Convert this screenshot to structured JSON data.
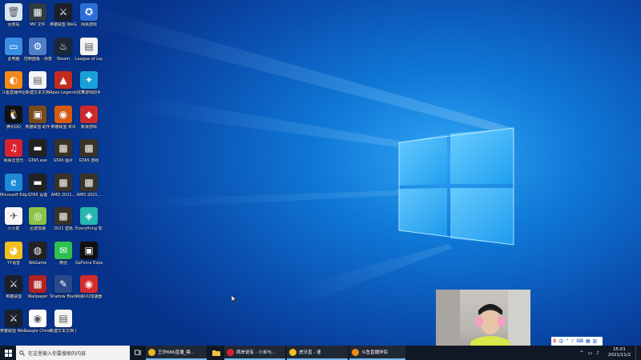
{
  "desktop_icons": [
    {
      "label": "回收站",
      "color": "#d8e4ef",
      "glyph": "🗑"
    },
    {
      "label": "MV 文件",
      "color": "#2f3a44",
      "glyph": "▦"
    },
    {
      "label": "英雄联盟 WeGame版",
      "color": "#1b1f2a",
      "glyph": "⚔"
    },
    {
      "label": "网易游戏",
      "color": "#2b6fd6",
      "glyph": "✪"
    },
    {
      "label": "此电脑",
      "color": "#3a8ee6",
      "glyph": "▭"
    },
    {
      "label": "控制面板 - 快捷方式",
      "color": "#4f7fc9",
      "glyph": "⚙"
    },
    {
      "label": "Steam",
      "color": "#1b2838",
      "glyph": "♨"
    },
    {
      "label": "League of Legends",
      "color": "#f4f4f4",
      "glyph": "▤"
    },
    {
      "label": "斗鱼直播伴侣",
      "color": "#f28a1a",
      "glyph": "◐"
    },
    {
      "label": "新建文本文档",
      "color": "#f4f4f4",
      "glyph": "▤"
    },
    {
      "label": "Apex Legends",
      "color": "#c42b1c",
      "glyph": "▲"
    },
    {
      "label": "炫舞游戏助手",
      "color": "#18a0d8",
      "glyph": "✦"
    },
    {
      "label": "腾讯QQ",
      "color": "#111111",
      "glyph": "🐧"
    },
    {
      "label": "英雄联盟 助手",
      "color": "#7a4a1a",
      "glyph": "▣"
    },
    {
      "label": "英雄联盟 资讯",
      "color": "#d45a12",
      "glyph": "◉"
    },
    {
      "label": "新浪游戏",
      "color": "#cc2b2b",
      "glyph": "◆"
    },
    {
      "label": "网易云音乐",
      "color": "#d8232f",
      "glyph": "♫"
    },
    {
      "label": "GTA5.exe",
      "color": "#222222",
      "glyph": "▬"
    },
    {
      "label": "GTA5 图片",
      "color": "#3a3228",
      "glyph": "▩"
    },
    {
      "label": "GTA5 游戏",
      "color": "#3a3228",
      "glyph": "▩"
    },
    {
      "label": "Microsoft Edge",
      "color": "#1e8ad6",
      "glyph": "e"
    },
    {
      "label": "GTA5 设置",
      "color": "#222222",
      "glyph": "▬"
    },
    {
      "label": "AMD 2021...",
      "color": "#3a3228",
      "glyph": "▩"
    },
    {
      "label": "AMD 2021...",
      "color": "#3a3228",
      "glyph": "▩"
    },
    {
      "label": "小火箭",
      "color": "#f6f6f6",
      "glyph": "✈"
    },
    {
      "label": "迅游加速",
      "color": "#8bc34a",
      "glyph": "◎"
    },
    {
      "label": "2021 壁纸",
      "color": "#3a3228",
      "glyph": "▩"
    },
    {
      "label": "Everything 软件",
      "color": "#25b7b0",
      "glyph": "◈"
    },
    {
      "label": "YY语音",
      "color": "#f0c020",
      "glyph": "◕"
    },
    {
      "label": "WeGame",
      "color": "#222222",
      "glyph": "◍"
    },
    {
      "label": "微信",
      "color": "#2ec04f",
      "glyph": "✉"
    },
    {
      "label": "GeForce Experience",
      "color": "#111111",
      "glyph": "▣"
    },
    {
      "label": "英雄联盟",
      "color": "#1b1f2a",
      "glyph": "⚔"
    },
    {
      "label": "Wallpaper",
      "color": "#b02323",
      "glyph": "▦"
    },
    {
      "label": "Shadow Blade",
      "color": "#2a4a8a",
      "glyph": "✎"
    },
    {
      "label": "网易UU加速器",
      "color": "#d42b2b",
      "glyph": "◉"
    },
    {
      "label": "英雄联盟 WeGame版",
      "color": "#1b1f2a",
      "glyph": "⚔"
    },
    {
      "label": "Google Chrome",
      "color": "#ffffff",
      "glyph": "◉"
    },
    {
      "label": "新建文本文档 (2)",
      "color": "#f4f4f4",
      "glyph": "▤"
    }
  ],
  "taskbar": {
    "search_placeholder": "在这里输入你要搜索的内容",
    "apps": [
      {
        "label": "王炸666直播_鼎...",
        "color": "#e8b923"
      },
      {
        "label": "两岸说有 - 小米与...",
        "color": "#d8232f"
      },
      {
        "label": "虎牙直 - 速",
        "color": "#f0c020"
      },
      {
        "label": "斗鱼直播伴侣",
        "color": "#f28a1a"
      }
    ],
    "clock_time": "15:01",
    "clock_date": "2021/11/2"
  },
  "ime_bar": {
    "items": [
      "S",
      "中",
      "°",
      "♪",
      "⌨",
      "▦",
      "▥"
    ]
  },
  "colors": {
    "accent": "#0f78d6",
    "taskbar": "#101826"
  }
}
